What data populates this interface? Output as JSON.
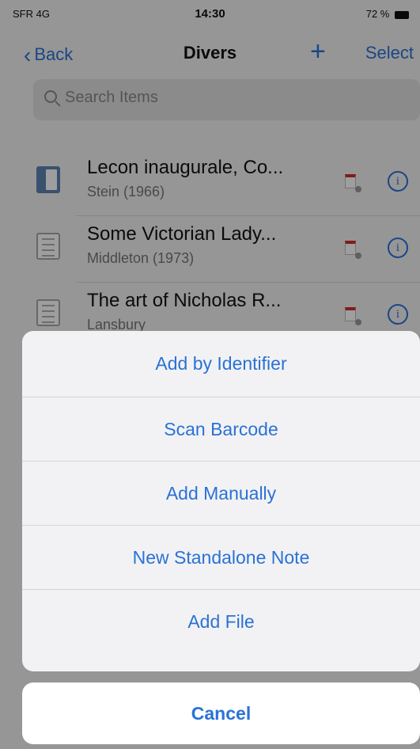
{
  "status_bar": {
    "carrier": "SFR 4G",
    "time": "14:30",
    "battery": "72 %"
  },
  "nav": {
    "back_label": "Back",
    "title": "Divers",
    "add_label": "+",
    "select_label": "Select"
  },
  "search": {
    "placeholder": "Search Items"
  },
  "items": [
    {
      "title": "Lecon inaugurale, Co...",
      "subtitle": "Stein (1966)",
      "icon": "book-icon"
    },
    {
      "title": "Some Victorian Lady...",
      "subtitle": "Middleton (1973)",
      "icon": "document-icon"
    },
    {
      "title": "The art of Nicholas R...",
      "subtitle": "Lansbury",
      "icon": "document-icon"
    }
  ],
  "action_sheet": {
    "options": [
      "Add by Identifier",
      "Scan Barcode",
      "Add Manually",
      "New Standalone Note",
      "Add File"
    ],
    "cancel_label": "Cancel"
  },
  "colors": {
    "accent": "#2a72d6",
    "pdf_red": "#d12d2d"
  }
}
